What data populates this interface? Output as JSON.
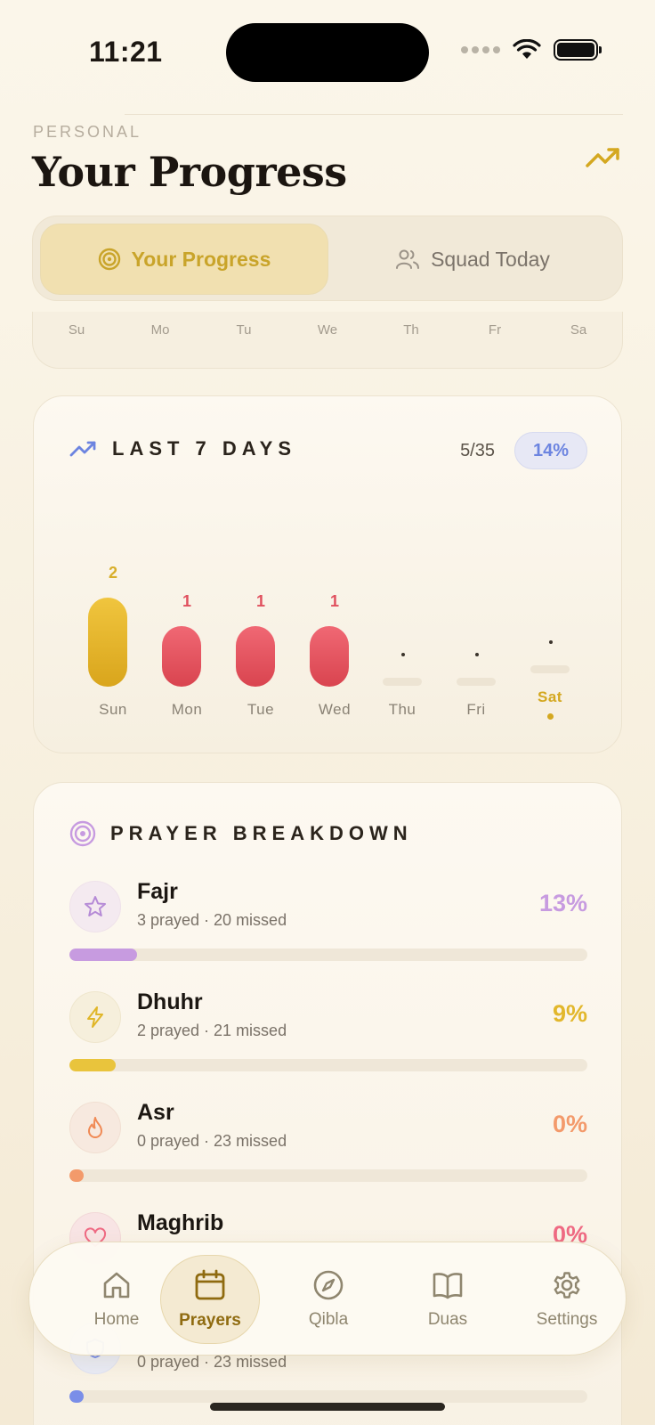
{
  "status_bar": {
    "time": "11:21"
  },
  "header": {
    "eyebrow": "PERSONAL",
    "title": "Your Progress"
  },
  "segmented": {
    "active_label": "Your Progress",
    "inactive_label": "Squad Today"
  },
  "calendar_days": [
    "Su",
    "Mo",
    "Tu",
    "We",
    "Th",
    "Fr",
    "Sa"
  ],
  "week_card": {
    "title": "LAST 7 DAYS",
    "count": "5/35",
    "percent": "14%",
    "days": [
      {
        "label": "Sun",
        "value": "2"
      },
      {
        "label": "Mon",
        "value": "1"
      },
      {
        "label": "Tue",
        "value": "1"
      },
      {
        "label": "Wed",
        "value": "1"
      },
      {
        "label": "Thu",
        "value": ""
      },
      {
        "label": "Fri",
        "value": ""
      },
      {
        "label": "Sat",
        "value": ""
      }
    ]
  },
  "breakdown": {
    "title": "PRAYER BREAKDOWN",
    "rows": [
      {
        "name": "Fajr",
        "sub": "3 prayed · 20 missed",
        "pct": "13%",
        "fraction": 0.13,
        "color": "#c79be0",
        "icon": "star-icon"
      },
      {
        "name": "Dhuhr",
        "sub": "2 prayed · 21 missed",
        "pct": "9%",
        "fraction": 0.09,
        "color": "#e9c43c",
        "icon": "lightning-icon"
      },
      {
        "name": "Asr",
        "sub": "0 prayed · 23 missed",
        "pct": "0%",
        "fraction": 0.0,
        "color": "#f39a6b",
        "icon": "flame-icon"
      },
      {
        "name": "Maghrib",
        "sub": "",
        "pct": "0%",
        "fraction": 0.0,
        "color": "#ef6a83",
        "icon": "heart-icon"
      },
      {
        "name": "",
        "sub": "0 prayed · 23 missed",
        "pct": "",
        "fraction": 0.0,
        "color": "#7a8ee8",
        "icon": "shield-icon"
      }
    ]
  },
  "tabbar": {
    "items": [
      {
        "label": "Home",
        "icon": "home-icon"
      },
      {
        "label": "Prayers",
        "icon": "calendar-icon"
      },
      {
        "label": "Qibla",
        "icon": "compass-icon"
      },
      {
        "label": "Duas",
        "icon": "book-icon"
      },
      {
        "label": "Settings",
        "icon": "gear-icon"
      }
    ],
    "active": "Prayers"
  },
  "colors": {
    "gold": "#d4a820",
    "red": "#e0505e",
    "blue": "#6c84e0",
    "purple": "#c79be0"
  }
}
